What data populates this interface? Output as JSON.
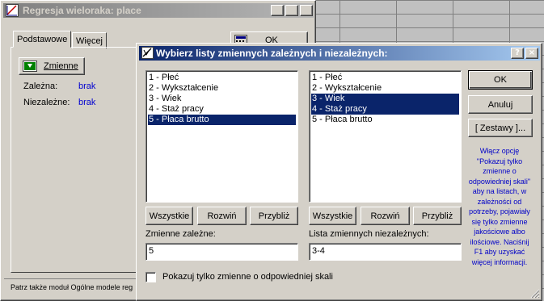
{
  "back_window": {
    "title": "Regresja wieloraka: place",
    "tabs": [
      {
        "label": "Podstawowe",
        "active": true
      },
      {
        "label": "Więcej",
        "active": false
      }
    ],
    "ok_label": "OK",
    "variables_button": "Zmienne",
    "dependent_label": "Zależna:",
    "dependent_value": "brak",
    "independent_label": "Niezależne:",
    "independent_value": "brak",
    "status_text": "Patrz także moduł Ogólne modele reg"
  },
  "dialog": {
    "title": "Wybierz listy zmiennych zależnych i niezależnych:",
    "left_list": [
      {
        "label": "1 - Płeć",
        "selected": false
      },
      {
        "label": "2 - Wykształcenie",
        "selected": false
      },
      {
        "label": "3 - Wiek",
        "selected": false
      },
      {
        "label": "4 - Staż pracy",
        "selected": false
      },
      {
        "label": "5 - Płaca brutto",
        "selected": true
      }
    ],
    "right_list": [
      {
        "label": "1 - Płeć",
        "selected": false
      },
      {
        "label": "2 - Wykształcenie",
        "selected": false
      },
      {
        "label": "3 - Wiek",
        "selected": true
      },
      {
        "label": "4 - Staż pracy",
        "selected": true
      },
      {
        "label": "5 - Płaca brutto",
        "selected": false
      }
    ],
    "buttons": {
      "all": "Wszystkie",
      "expand": "Rozwiń",
      "zoom": "Przybliż",
      "ok": "OK",
      "cancel": "Anuluj",
      "sets": "[ Zestawy ]..."
    },
    "dependent_label": "Zmienne zależne:",
    "dependent_value": "5",
    "independent_label": "Lista zmiennych niezależnych:",
    "independent_value": "3-4",
    "checkbox_label": "Pokazuj tylko zmienne o odpowiedniej skali",
    "checkbox_checked": false,
    "help_text": "Włącz opcję \"Pokazuj tylko zmienne o odpowiedniej skali\" aby na listach, w zależności od potrzeby, pojawiały się tylko zmienne jakościowe albo ilościowe. Naciśnij F1 aby uzyskać więcej informacji."
  },
  "title_buttons": {
    "help": "?",
    "minimize": "_",
    "close": "×"
  }
}
